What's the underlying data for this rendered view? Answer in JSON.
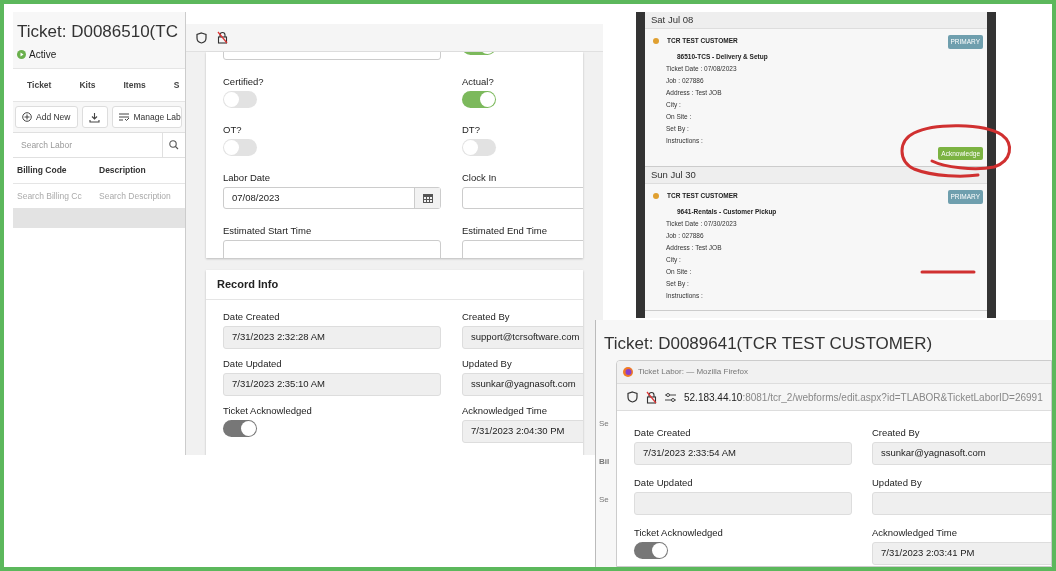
{
  "ticket_list": {
    "title": "Ticket: D0086510(TC",
    "status": "Active",
    "tabs": [
      "Ticket",
      "Kits",
      "Items",
      "S"
    ],
    "add_button": "Add New",
    "manage_button": "Manage Lab",
    "search": {
      "placeholder": "Search Labor"
    },
    "columns": [
      "Billing Code",
      "Description"
    ],
    "column_filters": [
      {
        "placeholder": "Search Billing Cc"
      },
      {
        "placeholder": "Search Description"
      }
    ]
  },
  "labor_form": {
    "fields": [
      {
        "kind": "input"
      },
      {
        "kind": "toggle",
        "on": true,
        "disabled": false
      },
      {
        "kind": "toggle",
        "label": "Certified?",
        "on": false,
        "disabled": false
      },
      {
        "kind": "toggle",
        "label": "Actual?",
        "on": true,
        "disabled": false
      },
      {
        "kind": "toggle",
        "label": "OT?",
        "on": false,
        "disabled": false
      },
      {
        "kind": "toggle",
        "label": "DT?",
        "on": false,
        "disabled": false
      },
      {
        "kind": "date",
        "label": "Labor Date",
        "value": "07/08/2023"
      },
      {
        "kind": "input",
        "label": "Clock In"
      },
      {
        "kind": "input",
        "label": "Estimated Start Time"
      },
      {
        "kind": "input",
        "label": "Estimated End Time"
      }
    ]
  },
  "record_info": {
    "title": "Record Info",
    "fields": [
      {
        "kind": "readonly",
        "label": "Date Created",
        "value": "7/31/2023 2:32:28 AM"
      },
      {
        "kind": "readonly",
        "label": "Created By",
        "value": "support@tcrsoftware.com"
      },
      {
        "kind": "readonly",
        "label": "Date Updated",
        "value": "7/31/2023 2:35:10 AM"
      },
      {
        "kind": "readonly",
        "label": "Updated By",
        "value": "ssunkar@yagnasoft.com"
      },
      {
        "kind": "toggle",
        "label": "Ticket Acknowledged",
        "on": true,
        "disabled": true
      },
      {
        "kind": "readonly",
        "label": "Acknowledged Time",
        "value": "7/31/2023 2:04:30 PM"
      }
    ]
  },
  "calendar": {
    "days": [
      {
        "date": "Sat Jul 08",
        "events": [
          {
            "customer": "TCR TEST CUSTOMER",
            "color": "#e0a030",
            "title": "86510-TCS - Delivery & Setup",
            "badge": "PRIMARY",
            "details": [
              "Ticket Date : 07/08/2023",
              "Job : 027886",
              "Address : Test JOB",
              "City :",
              "On Site :",
              "Set By :",
              "Instructions :"
            ],
            "action": "Acknowledge"
          }
        ]
      },
      {
        "date": "Sun Jul 30",
        "events": [
          {
            "customer": "TCR TEST CUSTOMER",
            "color": "#e0a030",
            "title": "9641-Rentals - Customer Pickup",
            "badge": "PRIMARY",
            "details": [
              "Ticket Date : 07/30/2023",
              "Job : 027886",
              "Address : Test JOB",
              "City :",
              "On Site :",
              "Set By :",
              "Instructions :"
            ]
          }
        ]
      }
    ]
  },
  "second_ticket": {
    "title": "Ticket: D0089641(TCR TEST CUSTOMER)",
    "behind_texts": [
      "Se",
      "Bil",
      "Se"
    ],
    "window": {
      "title": "Ticket Labor: — Mozilla Firefox",
      "url_host": "52.183.44.10",
      "url_path": ":8081/tcr_2/webforms/edit.aspx?id=TLABOR&TicketLaborID=26991"
    },
    "fields": [
      {
        "kind": "readonly",
        "label": "Date Created",
        "value": "7/31/2023 2:33:54 AM"
      },
      {
        "kind": "readonly",
        "label": "Created By",
        "value": "ssunkar@yagnasoft.com"
      },
      {
        "kind": "readonly",
        "label": "Date Updated"
      },
      {
        "kind": "readonly",
        "label": "Updated By"
      },
      {
        "kind": "toggle",
        "label": "Ticket Acknowledged",
        "on": true,
        "disabled": true
      },
      {
        "kind": "readonly",
        "label": "Acknowledged Time",
        "value": "7/31/2023 2:03:41 PM"
      }
    ]
  }
}
